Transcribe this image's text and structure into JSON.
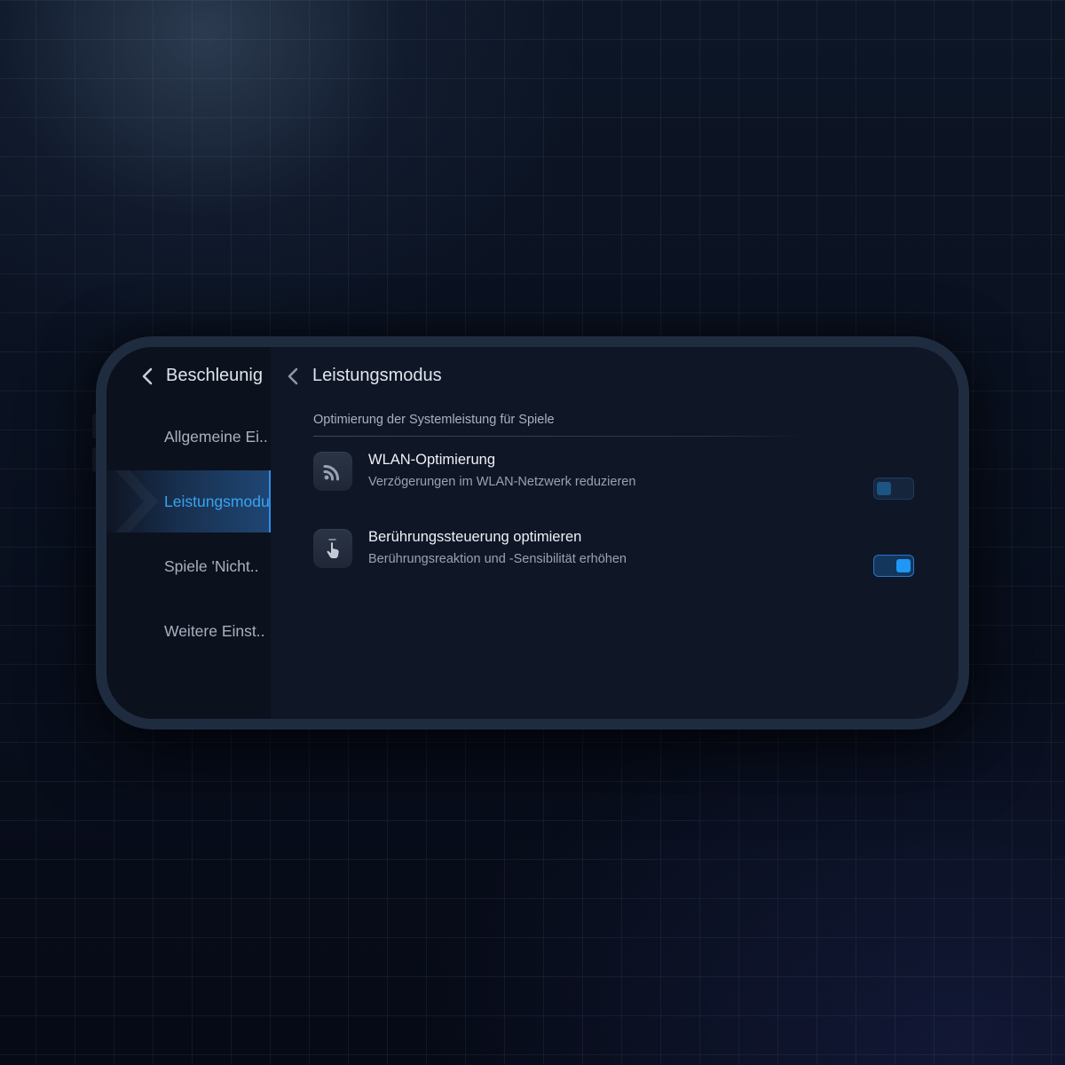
{
  "sidebar": {
    "back_title": "Beschleunig",
    "items": [
      {
        "label": "Allgemeine Ei..",
        "active": false
      },
      {
        "label": "Leistungsmodus",
        "active": true
      },
      {
        "label": "Spiele 'Nicht..",
        "active": false
      },
      {
        "label": "Weitere Einst..",
        "active": false
      }
    ]
  },
  "content": {
    "title": "Leistungsmodus",
    "section_description": "Optimierung der Systemleistung für Spiele",
    "settings": [
      {
        "icon": "wifi-icon",
        "title": "WLAN-Optimierung",
        "subtitle": "Verzögerungen im WLAN-Netzwerk reduzieren",
        "enabled": false
      },
      {
        "icon": "touch-icon",
        "title": "Berührungssteuerung optimieren",
        "subtitle": "Berührungsreaktion und -Sensibilität erhöhen",
        "enabled": true
      }
    ]
  },
  "colors": {
    "accent": "#1e97f6",
    "active_text": "#38a3f2",
    "background": "#0e1524"
  }
}
